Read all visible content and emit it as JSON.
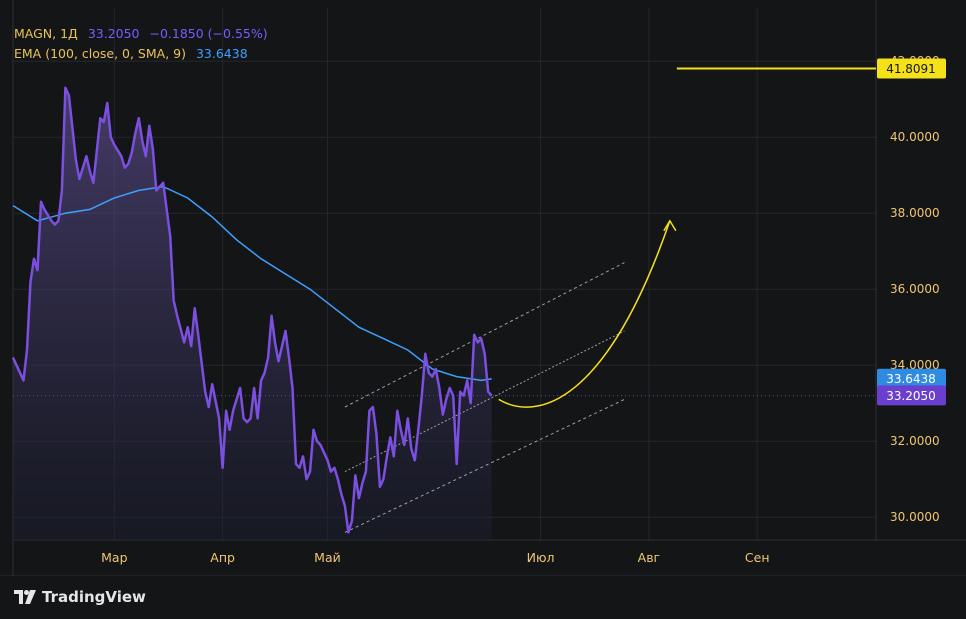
{
  "legend": {
    "symbol": "MAGN, 1Д",
    "price": "33.2050",
    "change": "−0.1850 (−0.55%)",
    "ema_label": "EMA (100, close, 0, SMA, 9)",
    "ema_value": "33.6438"
  },
  "brand": {
    "name": "TradingView"
  },
  "colors": {
    "background": "#141517",
    "price_line": "#7b4fe0",
    "ema_line": "#3ea0ff",
    "target_line": "#f5e11a",
    "axis_text": "#f0c674",
    "grid": "#24262b"
  },
  "chart_data": {
    "type": "area",
    "title": "",
    "xlabel": "",
    "ylabel": "",
    "ylim": [
      29.4,
      43.4
    ],
    "y_ticks": [
      "30.0000",
      "32.0000",
      "34.0000",
      "36.0000",
      "38.0000",
      "40.0000",
      "42.0000"
    ],
    "x_ticks": [
      {
        "label": "Мар",
        "date": "2024-03-01"
      },
      {
        "label": "Апр",
        "date": "2024-04-01"
      },
      {
        "label": "Май",
        "date": "2024-05-01"
      },
      {
        "label": "Июл",
        "date": "2024-07-01"
      },
      {
        "label": "Авг",
        "date": "2024-08-01"
      },
      {
        "label": "Сен",
        "date": "2024-09-01"
      }
    ],
    "xlim": [
      "2024-02-01",
      "2024-10-05"
    ],
    "series": [
      {
        "name": "MAGN",
        "points": [
          [
            "2024-02-01",
            34.2
          ],
          [
            "2024-02-03",
            33.8
          ],
          [
            "2024-02-04",
            33.6
          ],
          [
            "2024-02-05",
            34.4
          ],
          [
            "2024-02-06",
            36.2
          ],
          [
            "2024-02-07",
            36.8
          ],
          [
            "2024-02-08",
            36.5
          ],
          [
            "2024-02-09",
            38.3
          ],
          [
            "2024-02-10",
            38.1
          ],
          [
            "2024-02-12",
            37.8
          ],
          [
            "2024-02-13",
            37.7
          ],
          [
            "2024-02-14",
            37.8
          ],
          [
            "2024-02-15",
            38.6
          ],
          [
            "2024-02-16",
            41.3
          ],
          [
            "2024-02-17",
            41.1
          ],
          [
            "2024-02-19",
            39.4
          ],
          [
            "2024-02-20",
            38.9
          ],
          [
            "2024-02-22",
            39.5
          ],
          [
            "2024-02-23",
            39.1
          ],
          [
            "2024-02-24",
            38.8
          ],
          [
            "2024-02-26",
            40.5
          ],
          [
            "2024-02-27",
            40.4
          ],
          [
            "2024-02-28",
            40.9
          ],
          [
            "2024-02-29",
            40.0
          ],
          [
            "2024-03-01",
            39.8
          ],
          [
            "2024-03-03",
            39.5
          ],
          [
            "2024-03-04",
            39.2
          ],
          [
            "2024-03-05",
            39.3
          ],
          [
            "2024-03-06",
            39.6
          ],
          [
            "2024-03-07",
            40.1
          ],
          [
            "2024-03-08",
            40.5
          ],
          [
            "2024-03-09",
            39.9
          ],
          [
            "2024-03-10",
            39.5
          ],
          [
            "2024-03-11",
            40.3
          ],
          [
            "2024-03-12",
            39.7
          ],
          [
            "2024-03-13",
            38.6
          ],
          [
            "2024-03-15",
            38.8
          ],
          [
            "2024-03-17",
            37.4
          ],
          [
            "2024-03-18",
            35.7
          ],
          [
            "2024-03-19",
            35.3
          ],
          [
            "2024-03-21",
            34.6
          ],
          [
            "2024-03-22",
            35.0
          ],
          [
            "2024-03-23",
            34.5
          ],
          [
            "2024-03-24",
            35.5
          ],
          [
            "2024-03-25",
            34.8
          ],
          [
            "2024-03-27",
            33.3
          ],
          [
            "2024-03-28",
            32.9
          ],
          [
            "2024-03-29",
            33.5
          ],
          [
            "2024-03-31",
            32.6
          ],
          [
            "2024-04-01",
            31.3
          ],
          [
            "2024-04-02",
            32.8
          ],
          [
            "2024-04-03",
            32.3
          ],
          [
            "2024-04-04",
            32.8
          ],
          [
            "2024-04-05",
            33.1
          ],
          [
            "2024-04-06",
            33.4
          ],
          [
            "2024-04-07",
            32.6
          ],
          [
            "2024-04-08",
            32.5
          ],
          [
            "2024-04-09",
            32.6
          ],
          [
            "2024-04-10",
            33.4
          ],
          [
            "2024-04-11",
            32.6
          ],
          [
            "2024-04-12",
            33.6
          ],
          [
            "2024-04-13",
            33.8
          ],
          [
            "2024-04-14",
            34.2
          ],
          [
            "2024-04-15",
            35.3
          ],
          [
            "2024-04-16",
            34.6
          ],
          [
            "2024-04-17",
            34.1
          ],
          [
            "2024-04-18",
            34.5
          ],
          [
            "2024-04-19",
            34.9
          ],
          [
            "2024-04-20",
            34.2
          ],
          [
            "2024-04-21",
            33.4
          ],
          [
            "2024-04-22",
            31.4
          ],
          [
            "2024-04-23",
            31.3
          ],
          [
            "2024-04-24",
            31.6
          ],
          [
            "2024-04-25",
            31.0
          ],
          [
            "2024-04-26",
            31.2
          ],
          [
            "2024-04-27",
            32.3
          ],
          [
            "2024-04-28",
            32.0
          ],
          [
            "2024-04-29",
            31.9
          ],
          [
            "2024-05-01",
            31.5
          ],
          [
            "2024-05-02",
            31.2
          ],
          [
            "2024-05-03",
            31.3
          ],
          [
            "2024-05-04",
            31.0
          ],
          [
            "2024-05-05",
            30.6
          ],
          [
            "2024-05-06",
            30.3
          ],
          [
            "2024-05-07",
            29.6
          ],
          [
            "2024-05-08",
            29.9
          ],
          [
            "2024-05-09",
            31.1
          ],
          [
            "2024-05-10",
            30.5
          ],
          [
            "2024-05-11",
            30.9
          ],
          [
            "2024-05-12",
            31.2
          ],
          [
            "2024-05-13",
            32.8
          ],
          [
            "2024-05-14",
            32.9
          ],
          [
            "2024-05-15",
            32.2
          ],
          [
            "2024-05-16",
            30.8
          ],
          [
            "2024-05-17",
            31.0
          ],
          [
            "2024-05-18",
            31.6
          ],
          [
            "2024-05-19",
            32.1
          ],
          [
            "2024-05-20",
            31.6
          ],
          [
            "2024-05-21",
            32.8
          ],
          [
            "2024-05-22",
            32.3
          ],
          [
            "2024-05-23",
            31.9
          ],
          [
            "2024-05-24",
            32.6
          ],
          [
            "2024-05-25",
            31.8
          ],
          [
            "2024-05-26",
            31.5
          ],
          [
            "2024-05-27",
            32.3
          ],
          [
            "2024-05-28",
            33.2
          ],
          [
            "2024-05-29",
            34.3
          ],
          [
            "2024-05-30",
            33.8
          ],
          [
            "2024-05-31",
            33.7
          ],
          [
            "2024-06-01",
            33.9
          ],
          [
            "2024-06-02",
            33.4
          ],
          [
            "2024-06-03",
            32.7
          ],
          [
            "2024-06-04",
            33.1
          ],
          [
            "2024-06-05",
            33.4
          ],
          [
            "2024-06-06",
            33.2
          ],
          [
            "2024-06-07",
            31.4
          ],
          [
            "2024-06-08",
            33.3
          ],
          [
            "2024-06-09",
            33.2
          ],
          [
            "2024-06-10",
            33.6
          ],
          [
            "2024-06-11",
            33.0
          ],
          [
            "2024-06-12",
            34.8
          ],
          [
            "2024-06-13",
            34.6
          ],
          [
            "2024-06-14",
            34.7
          ],
          [
            "2024-06-15",
            34.3
          ],
          [
            "2024-06-16",
            33.3
          ],
          [
            "2024-06-17",
            33.2
          ]
        ]
      },
      {
        "name": "EMA (100, close, 0, SMA, 9)",
        "points": [
          [
            "2024-02-01",
            38.2
          ],
          [
            "2024-02-08",
            37.8
          ],
          [
            "2024-02-16",
            38.0
          ],
          [
            "2024-02-23",
            38.1
          ],
          [
            "2024-03-01",
            38.4
          ],
          [
            "2024-03-08",
            38.6
          ],
          [
            "2024-03-15",
            38.7
          ],
          [
            "2024-03-22",
            38.4
          ],
          [
            "2024-03-29",
            37.9
          ],
          [
            "2024-04-05",
            37.3
          ],
          [
            "2024-04-12",
            36.8
          ],
          [
            "2024-04-19",
            36.4
          ],
          [
            "2024-04-26",
            36.0
          ],
          [
            "2024-05-03",
            35.5
          ],
          [
            "2024-05-10",
            35.0
          ],
          [
            "2024-05-17",
            34.7
          ],
          [
            "2024-05-24",
            34.4
          ],
          [
            "2024-05-31",
            33.9
          ],
          [
            "2024-06-07",
            33.7
          ],
          [
            "2024-06-14",
            33.6
          ],
          [
            "2024-06-17",
            33.64
          ]
        ]
      }
    ],
    "annotations": {
      "channel": {
        "upper": [
          [
            "2024-05-06",
            32.9
          ],
          [
            "2024-07-25",
            36.7
          ]
        ],
        "middle": [
          [
            "2024-05-06",
            31.2
          ],
          [
            "2024-07-25",
            34.9
          ]
        ],
        "lower": [
          [
            "2024-05-06",
            29.6
          ],
          [
            "2024-07-25",
            33.1
          ]
        ]
      },
      "forecast_curve": {
        "start": [
          "2024-06-19",
          33.1
        ],
        "control1": [
          "2024-06-30",
          32.5
        ],
        "control2": [
          "2024-07-20",
          33.0
        ],
        "end": [
          "2024-08-07",
          37.8
        ]
      },
      "target_line": {
        "value": 41.8091,
        "from": "2024-08-09"
      }
    },
    "price_labels": [
      {
        "text": "41.8091",
        "value": 41.8091,
        "bg": "#f5e11a",
        "fg": "#141517"
      },
      {
        "text": "33.6438",
        "value": 33.6438,
        "bg": "#2f8be0",
        "fg": "#ffffff"
      },
      {
        "text": "33.2050",
        "value": 33.205,
        "bg": "#6a3fd0",
        "fg": "#ffffff"
      }
    ],
    "grid": true,
    "legend_position": "top-left"
  }
}
